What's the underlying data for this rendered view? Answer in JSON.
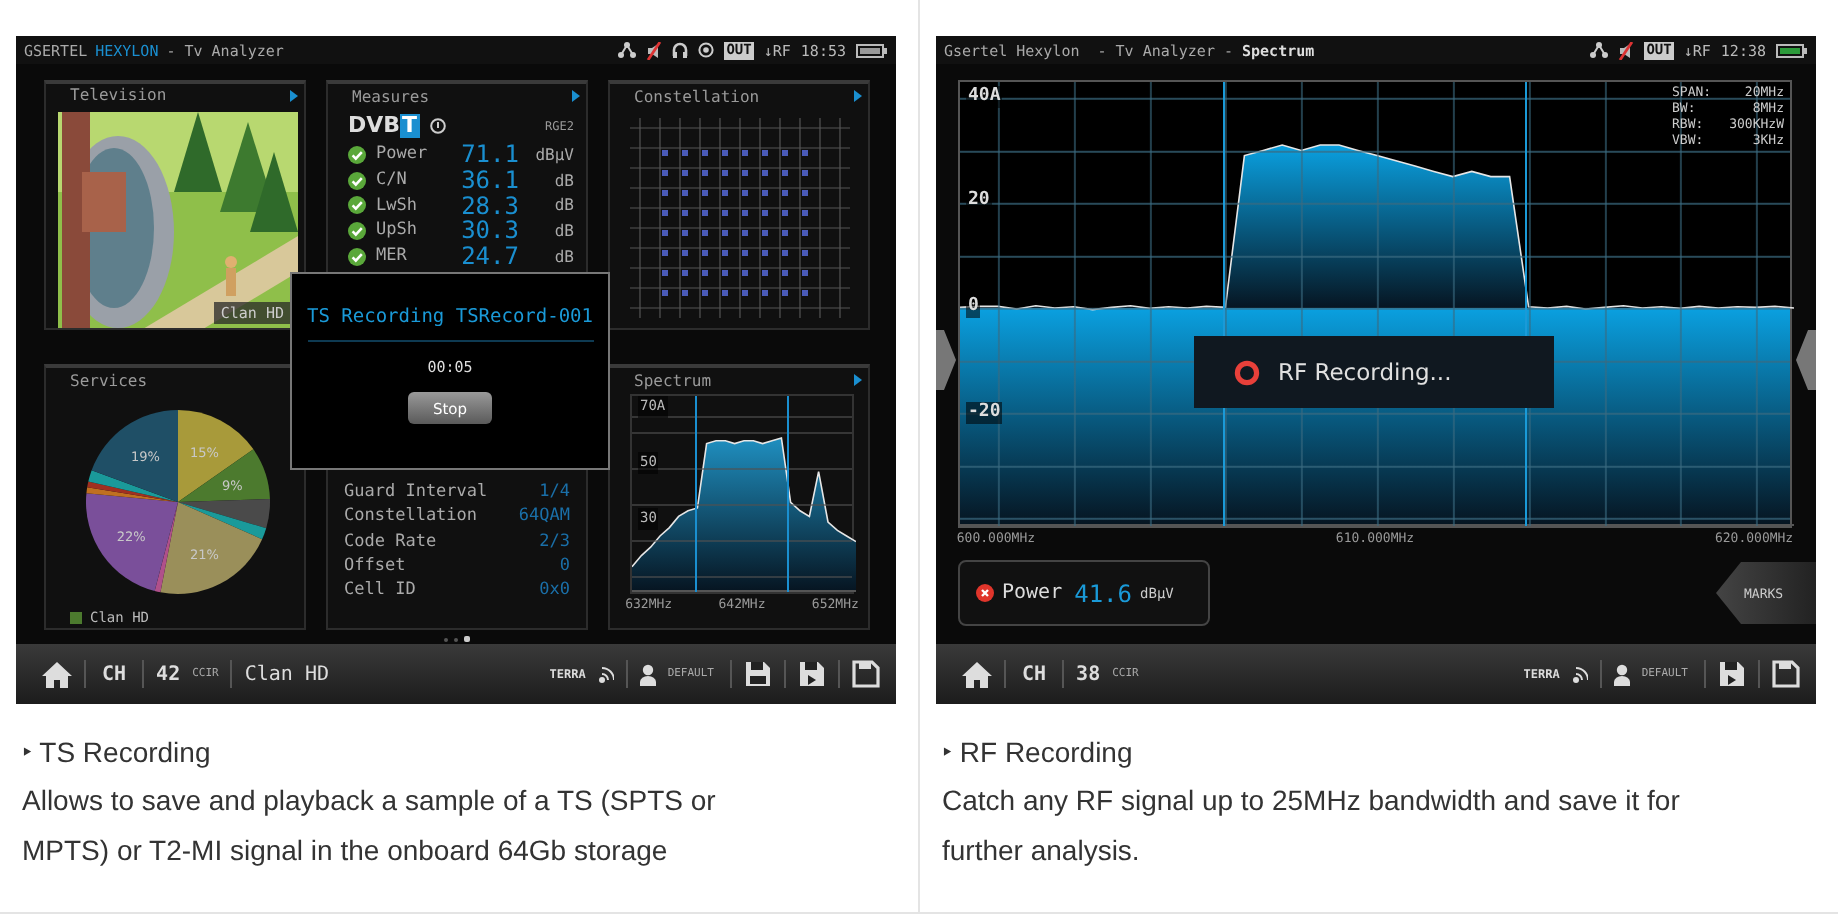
{
  "cards": [
    {
      "kind": "ts_recording",
      "screen": {
        "top_bar": {
          "title_parts": [
            {
              "text": "GSERTEL",
              "highlight": false
            },
            {
              "text": "HEXYLON",
              "highlight": true
            },
            {
              "text": "- Tv Analyzer",
              "highlight": false
            }
          ],
          "status_icons": [
            {
              "kind": "network"
            },
            {
              "kind": "muted_speaker"
            },
            {
              "kind": "headphones"
            },
            {
              "kind": "ring"
            }
          ],
          "out": "OUT",
          "rf": "↓RF",
          "time": "18:53",
          "battery_charging": false
        },
        "television": {
          "title": "Television",
          "channel": "Clan HD"
        },
        "measures": {
          "title": "Measures",
          "standard": "DVB",
          "standard_mark": "T",
          "region": "RGE2",
          "rows": [
            {
              "label": "Power",
              "value": "71.1",
              "unit": "dBµV",
              "ok": true
            },
            {
              "label": "C/N",
              "value": "36.1",
              "unit": "dB",
              "ok": true
            },
            {
              "label": "LwSh",
              "value": "28.3",
              "unit": "dB",
              "ok": true
            },
            {
              "label": "UpSh",
              "value": "30.3",
              "unit": "dB",
              "ok": true
            },
            {
              "label": "MER",
              "value": "24.7",
              "unit": "dB",
              "ok": true
            }
          ]
        },
        "constellation": {
          "title": "Constellation"
        },
        "services": {
          "title": "Services",
          "chart_data": {
            "type": "pie",
            "values": [
              15,
              9,
              5,
              2,
              21,
              1,
              22,
              1,
              1,
              2,
              19
            ],
            "value_labels": [
              "15%",
              "9%",
              null,
              null,
              "21%",
              null,
              "22%",
              null,
              null,
              null,
              "19%"
            ]
          },
          "legend": "Clan HD"
        },
        "parameters": {
          "rows": [
            {
              "label": "Guard Interval",
              "value": "1/4"
            },
            {
              "label": "Constellation",
              "value": "64QAM"
            },
            {
              "label": "Code Rate",
              "value": "2/3"
            },
            {
              "label": "Offset",
              "value": "0"
            },
            {
              "label": "Cell ID",
              "value": "0x0"
            }
          ]
        },
        "spectrum": {
          "title": "Spectrum",
          "chart_data": {
            "type": "area",
            "x": [
              630,
              631,
              632,
              633,
              634,
              635,
              636,
              637,
              638,
              639,
              640,
              641,
              642,
              643,
              644,
              645,
              646,
              647,
              648,
              649,
              650,
              651,
              652,
              653,
              654
            ],
            "series": [
              {
                "color": "#e6e6e6",
                "values": [
                  13,
                  17,
                  20,
                  24,
                  27,
                  31,
                  33,
                  34,
                  57,
                  58,
                  58,
                  57,
                  58,
                  58,
                  57,
                  58,
                  59,
                  36,
                  33,
                  31,
                  47,
                  29,
                  26,
                  24,
                  22
                ]
              }
            ],
            "xlim": [
              630,
              654
            ],
            "ylim": [
              4,
              74
            ],
            "xticks": [
              {
                "value": 632,
                "label": "632MHz"
              },
              {
                "value": 642,
                "label": "642MHz"
              },
              {
                "value": 652,
                "label": "652MHz"
              }
            ],
            "yticks": [
              {
                "value": 70,
                "label": "70A"
              },
              {
                "value": 50,
                "label": "50"
              },
              {
                "value": 30,
                "label": "30"
              }
            ]
          }
        },
        "pager": [
          {
            "selected": false
          },
          {
            "selected": false
          },
          {
            "selected": true
          }
        ],
        "dialog": {
          "title": "TS Recording TSRecord-001",
          "elapsed": "00:05",
          "button": "Stop"
        },
        "bottom_bar": {
          "ch": "CH",
          "channel": "42",
          "plan": "CCIR",
          "service": "Clan HD",
          "network": "TERRA",
          "profile": "DEFAULT",
          "save_buttons": [
            {
              "kind": "ts"
            },
            {
              "kind": "play"
            },
            {
              "kind": "plain"
            }
          ]
        }
      },
      "caption": {
        "title": "‣ TS Recording",
        "text": "Allows to save and playback a sample of a TS (SPTS or MPTS) or T2-MI signal in the onboard 64Gb storage"
      }
    },
    {
      "kind": "rf_recording",
      "screen": {
        "top_bar": {
          "title": "Gsertel Hexylon  - Tv Analyzer - **Spectrum**",
          "status_icons": [
            {
              "kind": "network"
            },
            {
              "kind": "muted_speaker"
            }
          ],
          "out": "OUT",
          "rf": "↓RF",
          "time": "12:38",
          "battery_charging": true
        },
        "chart": {
          "chart_data": {
            "type": "area",
            "x": [
              599,
              599.5,
              600,
              600.5,
              601,
              601.5,
              602,
              602.5,
              603,
              603.5,
              604,
              604.5,
              605,
              605.5,
              606,
              606.5,
              607,
              607.5,
              608,
              608.5,
              609,
              609.5,
              610,
              610.5,
              611,
              611.5,
              612,
              612.5,
              613,
              613.5,
              614,
              614.5,
              615,
              615.5,
              616,
              616.5,
              617,
              617.5,
              618,
              618.5,
              619,
              619.5,
              620,
              620.5,
              621
            ],
            "series": [
              {
                "color": "#e6e6e6",
                "values": [
                  0.1,
                  0.3,
                  0.3,
                  -0.2,
                  0.4,
                  0,
                  0.2,
                  -0.3,
                  0.1,
                  0.4,
                  -0.1,
                  0.2,
                  0,
                  0.3,
                  0.1,
                  29,
                  30,
                  31,
                  30,
                  31,
                  31,
                  30,
                  29,
                  28,
                  27,
                  26,
                  25,
                  26,
                  25,
                  25,
                  0.2,
                  0,
                  0.3,
                  -0.2,
                  0.1,
                  0.4,
                  0,
                  0.2,
                  -0.1,
                  0.3,
                  0,
                  0.2,
                  0.1,
                  0.3,
                  0
                ]
              }
            ],
            "xlim": [
              599,
              621
            ],
            "ylim": [
              -41.5,
              43
            ],
            "xticks": [
              {
                "value": 600,
                "label": "600.000MHz"
              },
              {
                "value": 610,
                "label": "610.000MHz"
              },
              {
                "value": 620,
                "label": "620.000MHz"
              }
            ],
            "yticks": [
              {
                "value": 40,
                "label": "40A"
              },
              {
                "value": 20,
                "label": "20"
              },
              {
                "value": 0,
                "label": "0"
              },
              {
                "value": -20,
                "label": "-20"
              }
            ]
          },
          "info": [
            {
              "label": "SPAN:",
              "value": "20MHz"
            },
            {
              "label": "BW:",
              "value": "8MHz"
            },
            {
              "label": "RBW:",
              "value": "300KHzW"
            },
            {
              "label": "VBW:",
              "value": "3KHz"
            }
          ]
        },
        "recording": "RF Recording...",
        "power": {
          "label": "Power",
          "value": "41.6",
          "unit": "dBµV",
          "ok": false
        },
        "marks": "MARKS",
        "bottom_bar": {
          "ch": "CH",
          "channel": "38",
          "plan": "CCIR",
          "network": "TERRA",
          "profile": "DEFAULT",
          "save_buttons": [
            {
              "kind": "play"
            },
            {
              "kind": "plain"
            }
          ]
        }
      },
      "caption": {
        "title": "‣ RF Recording",
        "text": "Catch any RF signal up to 25MHz bandwidth and save it for further analysis."
      }
    }
  ]
}
